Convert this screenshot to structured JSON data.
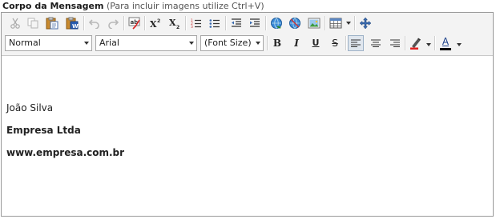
{
  "caption": {
    "label": "Corpo da Mensagem",
    "hint": "(Para incluir imagens utilize Ctrl+V)"
  },
  "toolbar1": {
    "icons": [
      "cut-icon",
      "copy-icon",
      "paste-icon",
      "paste-word-icon",
      "undo-icon",
      "redo-icon",
      "spellcheck-icon",
      "superscript-icon",
      "subscript-icon",
      "ordered-list-icon",
      "unordered-list-icon",
      "outdent-icon",
      "indent-icon",
      "link-icon",
      "unlink-icon",
      "image-icon",
      "table-icon",
      "move-icon"
    ]
  },
  "toolbar2": {
    "paragraph_format": "Normal",
    "font_name": "Arial",
    "font_size": "(Font Size)",
    "bold": "B",
    "italic": "I",
    "underline": "U",
    "strike": "S",
    "font_color_letter": "A",
    "colors": {
      "font_color": "#000000",
      "highlight": "#e02020"
    }
  },
  "body": {
    "lines": [
      "João Silva",
      "Empresa Ltda",
      "www.empresa.com.br"
    ]
  }
}
